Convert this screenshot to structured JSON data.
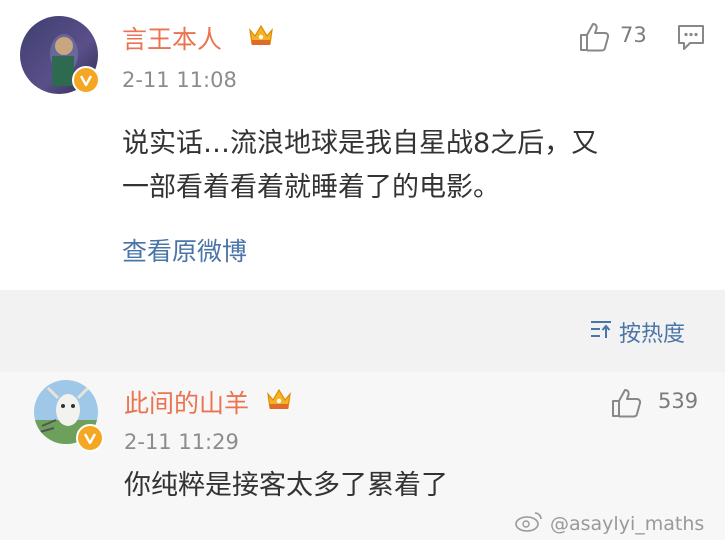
{
  "main_comment": {
    "username": "言王本人",
    "timestamp": "2-11 11:08",
    "like_count": "73",
    "text_line1": "说实话…流浪地球是我自星战8之后，又",
    "text_line2": "一部看着看着就睡着了的电影。",
    "view_original_label": "查看原微博"
  },
  "sort_label": "按热度",
  "reply": {
    "username": "此间的山羊",
    "timestamp": "2-11 11:29",
    "like_count": "539",
    "text": "你纯粹是接客太多了累着了"
  },
  "watermark": "@asaylyi_maths",
  "colors": {
    "name_orange": "#eb7350",
    "link_blue": "#4b74a8",
    "badge_gold": "#f5a623"
  },
  "icons": [
    "verified-badge-icon",
    "vip-crown-icon",
    "thumbs-up-icon",
    "comment-icon",
    "sort-icon",
    "weibo-logo-icon"
  ]
}
